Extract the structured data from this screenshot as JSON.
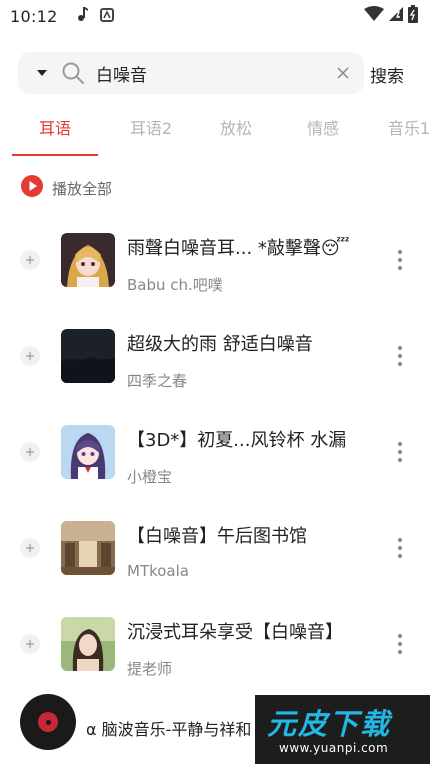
{
  "status": {
    "time": "10:12"
  },
  "search": {
    "query": "白噪音",
    "button_label": "搜索"
  },
  "tabs": [
    {
      "label": "耳语"
    },
    {
      "label": "耳语2"
    },
    {
      "label": "放松"
    },
    {
      "label": "情感"
    },
    {
      "label": "音乐1"
    }
  ],
  "play_all": {
    "label": "播放全部"
  },
  "songs": [
    {
      "title": "雨聲白噪音耳... *敲擊聲😴",
      "artist": "Babu ch.吧噗"
    },
    {
      "title": "超级大的雨 舒适白噪音",
      "artist": "四季之春"
    },
    {
      "title": "【3D*】初夏...风铃杯 水漏",
      "artist": "小橙宝"
    },
    {
      "title": "【白噪音】午后图书馆",
      "artist": "MTkoala"
    },
    {
      "title": "沉浸式耳朵享受【白噪音】",
      "artist": "提老师"
    }
  ],
  "player": {
    "now_playing": "α 脑波音乐-平静与祥和"
  },
  "watermark": {
    "logo": "元皮下载",
    "url": "www.yuanpi.com"
  },
  "colors": {
    "accent": "#e53935",
    "inactive_tab": "#b5b5b5",
    "search_bg": "#f5f5f7"
  }
}
